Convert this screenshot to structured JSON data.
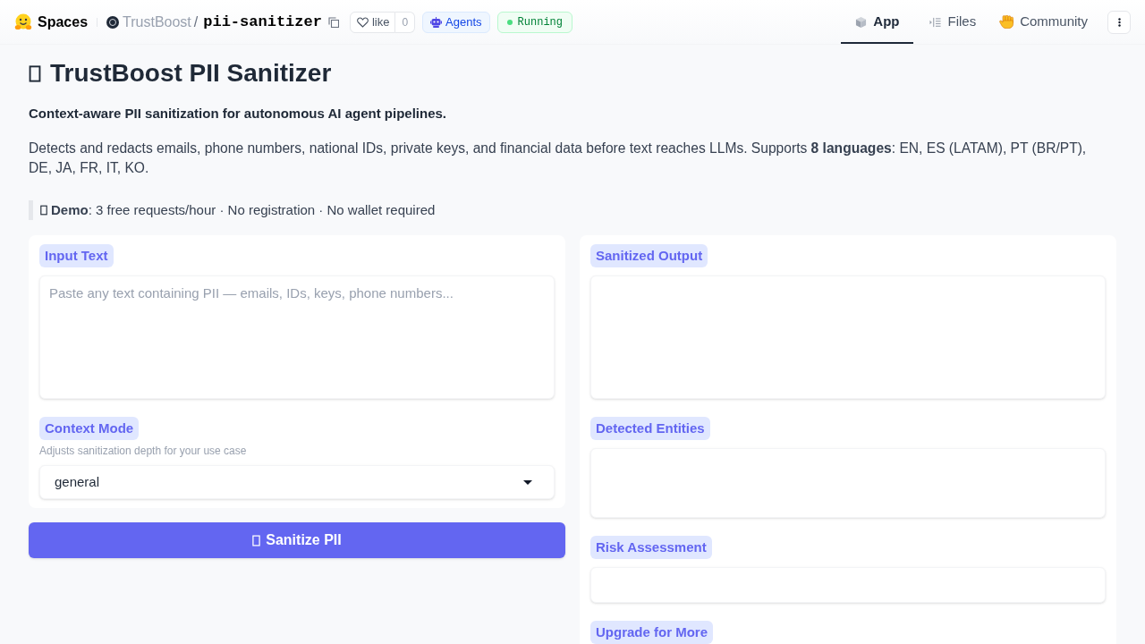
{
  "header": {
    "brand": "Spaces",
    "owner": "TrustBoost",
    "separator": "/",
    "repo": "pii-sanitizer",
    "like": {
      "label": "like",
      "count": "0"
    },
    "badges": [
      {
        "kind": "agents",
        "label": "Agents"
      },
      {
        "kind": "status",
        "label": "Running"
      }
    ],
    "tabs": [
      {
        "kind": "app",
        "label": "App",
        "selected": true
      },
      {
        "kind": "files",
        "label": "Files",
        "selected": false
      },
      {
        "kind": "community",
        "label": "Community",
        "selected": false
      }
    ]
  },
  "intro": {
    "title": "TrustBoost PII Sanitizer",
    "subtitle": "Context-aware PII sanitization for autonomous AI agent pipelines.",
    "description": "Detects and redacts emails, phone numbers, national IDs, private keys, and financial data before text reaches LLMs. Supports **8 languages**: EN, ES (LATAM), PT (BR/PT), DE, JA, FR, IT, KO.",
    "notice": "**Demo**: 3 free requests/hour · No registration · No wallet required"
  },
  "input_panel": {
    "text_label": "Input Text",
    "placeholder": "Paste any text containing PII — emails, IDs, keys, phone numbers...",
    "mode_label": "Context Mode",
    "mode_info": "Adjusts sanitization depth for your use case",
    "mode_value": "general"
  },
  "submit_button": "Sanitize PII",
  "output_panel": [
    {
      "kind": "textarea",
      "label": "Sanitized Output"
    },
    {
      "kind": "json",
      "label": "Detected Entities"
    },
    {
      "kind": "textbox",
      "label": "Risk Assessment"
    },
    {
      "kind": "markdown",
      "label": "Upgrade for More"
    }
  ]
}
